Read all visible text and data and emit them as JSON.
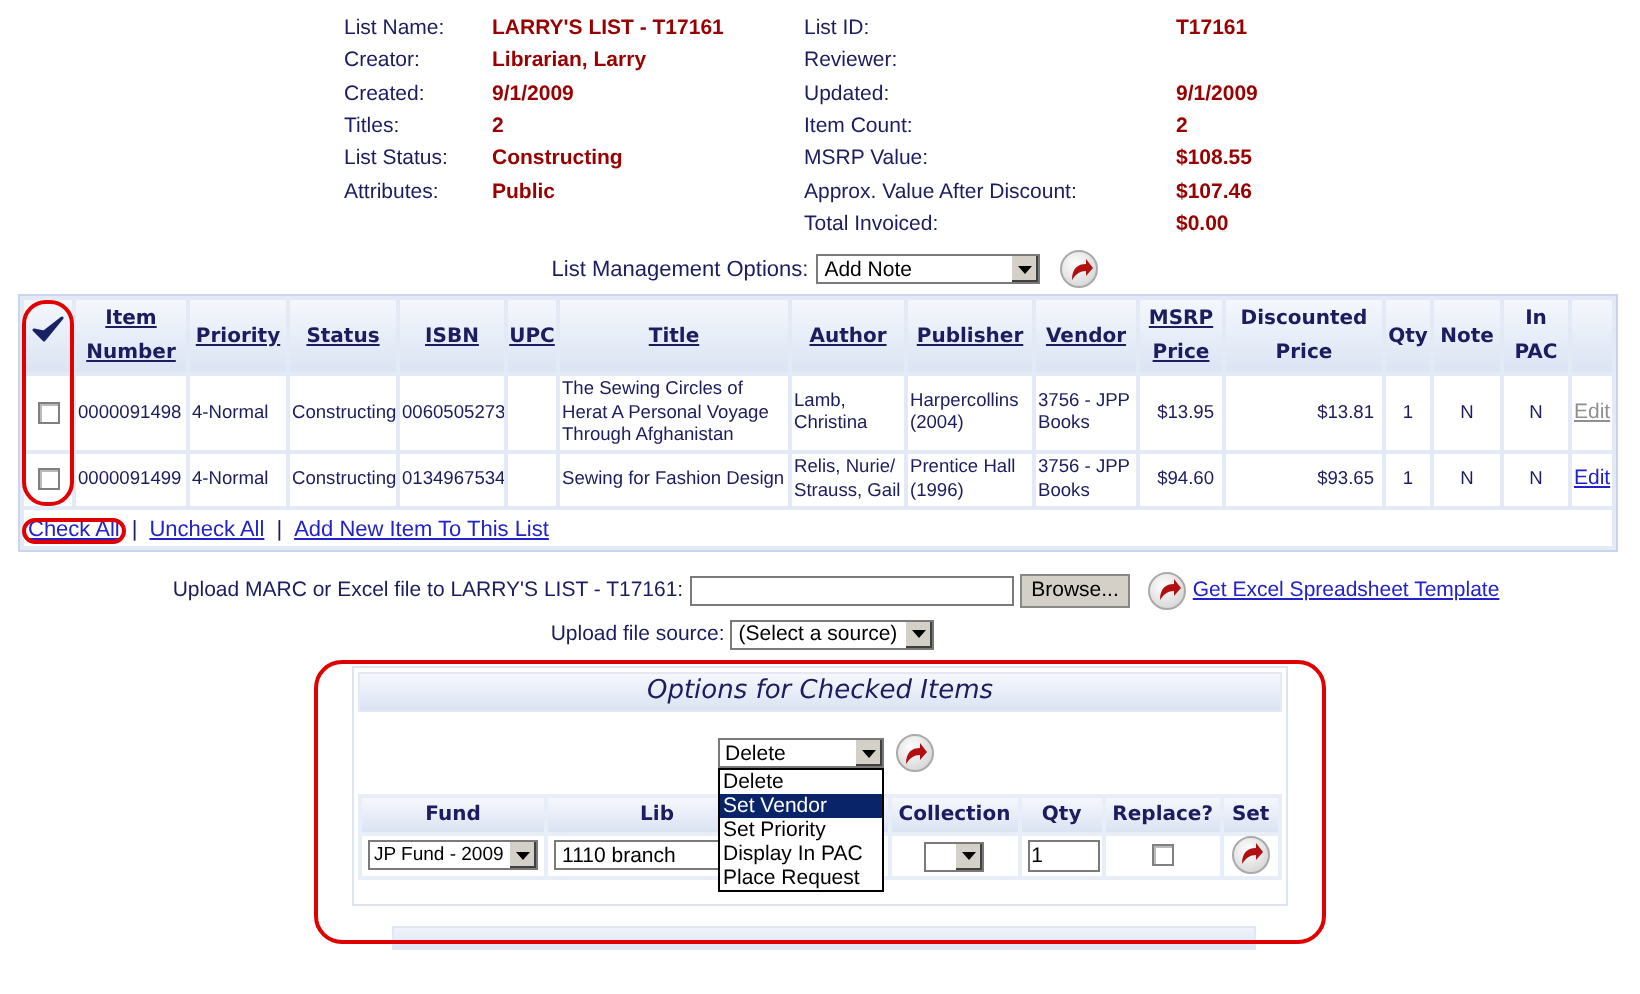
{
  "list_info": {
    "left": [
      {
        "label": "List Name:",
        "value": "LARRY'S LIST - T17161"
      },
      {
        "label": "Creator:",
        "value": "Librarian, Larry"
      },
      {
        "label": "Created:",
        "value": "9/1/2009"
      },
      {
        "label": "Titles:",
        "value": "2"
      },
      {
        "label": "List Status:",
        "value": "Constructing"
      },
      {
        "label": "Attributes:",
        "value": "Public"
      }
    ],
    "right": [
      {
        "label": "List ID:",
        "value": "T17161"
      },
      {
        "label": "Reviewer:"
      },
      {
        "label": "Updated:",
        "value": "9/1/2009"
      },
      {
        "label": "Item Count:",
        "value": "2"
      },
      {
        "label": "MSRP Value:",
        "value": "$108.55"
      },
      {
        "label": "Approx. Value After Discount:",
        "value": "$107.46"
      },
      {
        "label": "Total Invoiced:",
        "value": "$0.00"
      }
    ]
  },
  "list_management": {
    "label": "List Management Options:",
    "value": "Add Note"
  },
  "table": {
    "columns": [
      {
        "label": "Item Number",
        "sortable": true,
        "kind": "text"
      },
      {
        "label": "Priority",
        "sortable": true,
        "kind": "text"
      },
      {
        "label": "Status",
        "sortable": true,
        "kind": "text"
      },
      {
        "label": "ISBN",
        "sortable": true,
        "kind": "text"
      },
      {
        "label": "UPC",
        "sortable": true,
        "kind": "text"
      },
      {
        "label": "Title",
        "sortable": true,
        "kind": "text"
      },
      {
        "label": "Author",
        "sortable": true,
        "kind": "text"
      },
      {
        "label": "Publisher",
        "sortable": true,
        "kind": "text"
      },
      {
        "label": "Vendor",
        "sortable": true,
        "kind": "text"
      },
      {
        "label": "MSRP Price",
        "sortable": true,
        "kind": "money"
      },
      {
        "label": "Discounted Price",
        "sortable": false,
        "kind": "money"
      },
      {
        "label": "Qty",
        "sortable": false,
        "kind": "flag"
      },
      {
        "label": "Note",
        "sortable": false,
        "kind": "flag"
      },
      {
        "label": "In PAC",
        "sortable": false,
        "kind": "flag"
      }
    ],
    "rows": [
      {
        "checked": false,
        "cells": [
          "0000091498",
          "4-Normal",
          "Constructing",
          "0060505273",
          "",
          "The Sewing Circles of Herat A Personal Voyage Through Afghanistan",
          "Lamb, Christina",
          "Harpercollins (2004)",
          "3756 - JPP Books",
          "$13.95",
          "$13.81",
          "1",
          "N",
          "N"
        ],
        "edit": {
          "label": "Edit",
          "disabled": true
        }
      },
      {
        "checked": false,
        "cells": [
          "0000091499",
          "4-Normal",
          "Constructing",
          "0134967534",
          "",
          "Sewing for Fashion Design",
          "Relis, Nurie/ Strauss, Gail",
          "Prentice Hall (1996)",
          "3756 - JPP Books",
          "$94.60",
          "$93.65",
          "1",
          "N",
          "N"
        ],
        "edit": {
          "label": "Edit",
          "disabled": false
        }
      }
    ]
  },
  "links": {
    "items": [
      "Check All",
      "Uncheck All",
      "Add New Item To This List"
    ],
    "separator": "|"
  },
  "upload": {
    "label": "Upload MARC or Excel file to LARRY'S LIST - T17161:",
    "button": "Browse...",
    "link": "Get Excel Spreadsheet Template",
    "source_label": "Upload file source:",
    "source_value": "(Select a source)"
  },
  "options_panel": {
    "title": "Options for Checked Items",
    "action_value": "Delete",
    "menu": [
      {
        "label": "Delete",
        "selected": false
      },
      {
        "label": "Set Vendor",
        "selected": true
      },
      {
        "label": "Set Priority",
        "selected": false
      },
      {
        "label": "Display In PAC",
        "selected": false
      },
      {
        "label": "Place Request",
        "selected": false
      }
    ],
    "columns": [
      "Fund",
      "Lib",
      "Collection",
      "Qty",
      "Replace?",
      "Set"
    ],
    "fund": "JP Fund - 2009",
    "library": "1110 branch",
    "qty": "1",
    "replace": false
  },
  "highlights": [
    {
      "kind": "check_column"
    },
    {
      "kind": "check_all"
    },
    {
      "kind": "options"
    }
  ]
}
